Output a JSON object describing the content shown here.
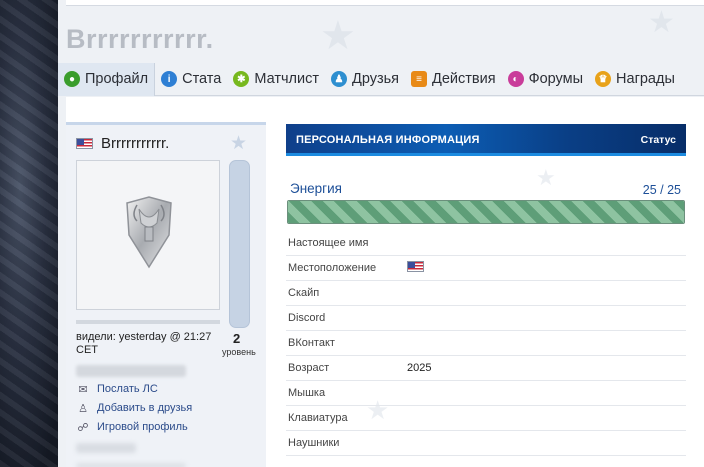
{
  "profile": {
    "username": "Brrrrrrrrrrr.",
    "card_name": "Brrrrrrrrrrr.",
    "last_seen": "видели: yesterday @ 21:27 CET",
    "level_value": "2",
    "level_label": "уровень"
  },
  "tabs": [
    {
      "label": "Профайл",
      "icon": "profile-icon",
      "color": "#3a9d2c"
    },
    {
      "label": "Стата",
      "icon": "info-icon",
      "color": "#2e7fd4"
    },
    {
      "label": "Матчлист",
      "icon": "matchlist-icon",
      "color": "#77b81e"
    },
    {
      "label": "Друзья",
      "icon": "friends-icon",
      "color": "#2e8fd0"
    },
    {
      "label": "Действия",
      "icon": "actions-icon",
      "color": "#e88a17"
    },
    {
      "label": "Форумы",
      "icon": "forums-icon",
      "color": "#c93d9a"
    },
    {
      "label": "Награды",
      "icon": "awards-icon",
      "color": "#e8a21a"
    }
  ],
  "actions": [
    {
      "label": "Послать ЛС",
      "icon": "mail-icon"
    },
    {
      "label": "Добавить в друзья",
      "icon": "add-friend-icon"
    },
    {
      "label": "Игровой профиль",
      "icon": "game-profile-icon"
    }
  ],
  "info": {
    "title": "ПЕРСОНАЛЬНАЯ ИНФОРМАЦИЯ",
    "status": "Статус",
    "energy_label": "Энергия",
    "energy_value": "25 / 25",
    "energy_fraction": 1.0,
    "fields": [
      {
        "key": "Настоящее имя",
        "value": ""
      },
      {
        "key": "Местоположение",
        "value": "",
        "flag": true
      },
      {
        "key": "Скайп",
        "value": ""
      },
      {
        "key": "Discord",
        "value": ""
      },
      {
        "key": "ВКонтакт",
        "value": ""
      },
      {
        "key": "Возраст",
        "value": "2025"
      },
      {
        "key": "Мышка",
        "value": ""
      },
      {
        "key": "Клавиатура",
        "value": ""
      },
      {
        "key": "Наушники",
        "value": ""
      }
    ]
  },
  "colors": {
    "accent": "#0c5db4",
    "link": "#2b4b8a",
    "energy": "#5e9e78"
  }
}
